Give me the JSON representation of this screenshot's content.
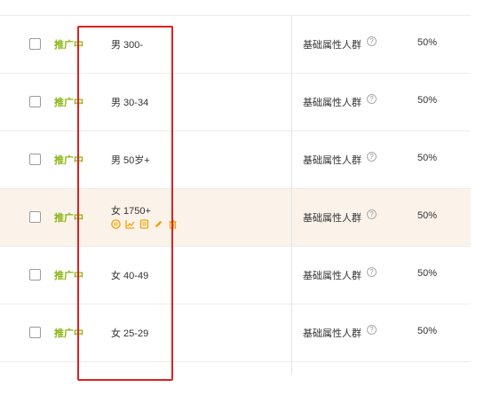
{
  "rows": [
    {
      "status": "推广中",
      "name": "男 300-",
      "crowd": "基础属性人群",
      "help": "?",
      "pct": "50%",
      "highlight": false
    },
    {
      "status": "推广中",
      "name": "男 30-34",
      "crowd": "基础属性人群",
      "help": "?",
      "pct": "50%",
      "highlight": false
    },
    {
      "status": "推广中",
      "name": "男 50岁+",
      "crowd": "基础属性人群",
      "help": "?",
      "pct": "50%",
      "highlight": false
    },
    {
      "status": "推广中",
      "name": "女 1750+",
      "crowd": "基础属性人群",
      "help": "?",
      "pct": "50%",
      "highlight": true
    },
    {
      "status": "推广中",
      "name": "女 40-49",
      "crowd": "基础属性人群",
      "help": "?",
      "pct": "50%",
      "highlight": false
    },
    {
      "status": "推广中",
      "name": "女 25-29",
      "crowd": "基础属性人群",
      "help": "?",
      "pct": "50%",
      "highlight": false
    }
  ],
  "row_actions": [
    "pause-icon",
    "chart-icon",
    "report-icon",
    "edit-icon",
    "delete-icon"
  ],
  "colors": {
    "status": "#8ab514",
    "action": "#f5a100",
    "highlight_bg": "#fbf3ea",
    "annotation": "#e02020"
  }
}
